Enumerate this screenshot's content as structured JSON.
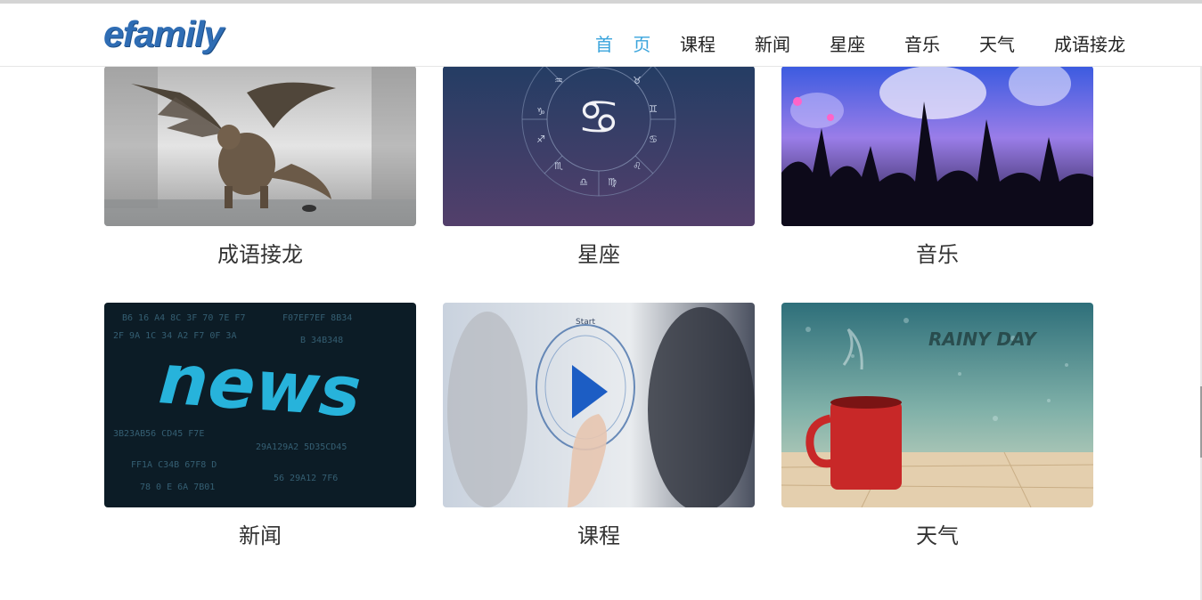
{
  "header": {
    "logo": "efamily",
    "nav": [
      {
        "label": "首 页",
        "active": true
      },
      {
        "label": "课程",
        "active": false
      },
      {
        "label": "新闻",
        "active": false
      },
      {
        "label": "星座",
        "active": false
      },
      {
        "label": "音乐",
        "active": false
      },
      {
        "label": "天气",
        "active": false
      },
      {
        "label": "成语接龙",
        "active": false
      }
    ]
  },
  "cards": [
    {
      "title": "成语接龙",
      "image": "dragon-image"
    },
    {
      "title": "星座",
      "image": "zodiac-image"
    },
    {
      "title": "音乐",
      "image": "concert-image"
    },
    {
      "title": "新闻",
      "image": "news-image"
    },
    {
      "title": "课程",
      "image": "play-button-image"
    },
    {
      "title": "天气",
      "image": "rainy-day-mug-image"
    }
  ],
  "images": {
    "news_word": "news",
    "rainy_text": "RAINY DAY",
    "course_start": "Start"
  },
  "colors": {
    "accent": "#3aa4dc",
    "logo": "#2f6db4"
  }
}
